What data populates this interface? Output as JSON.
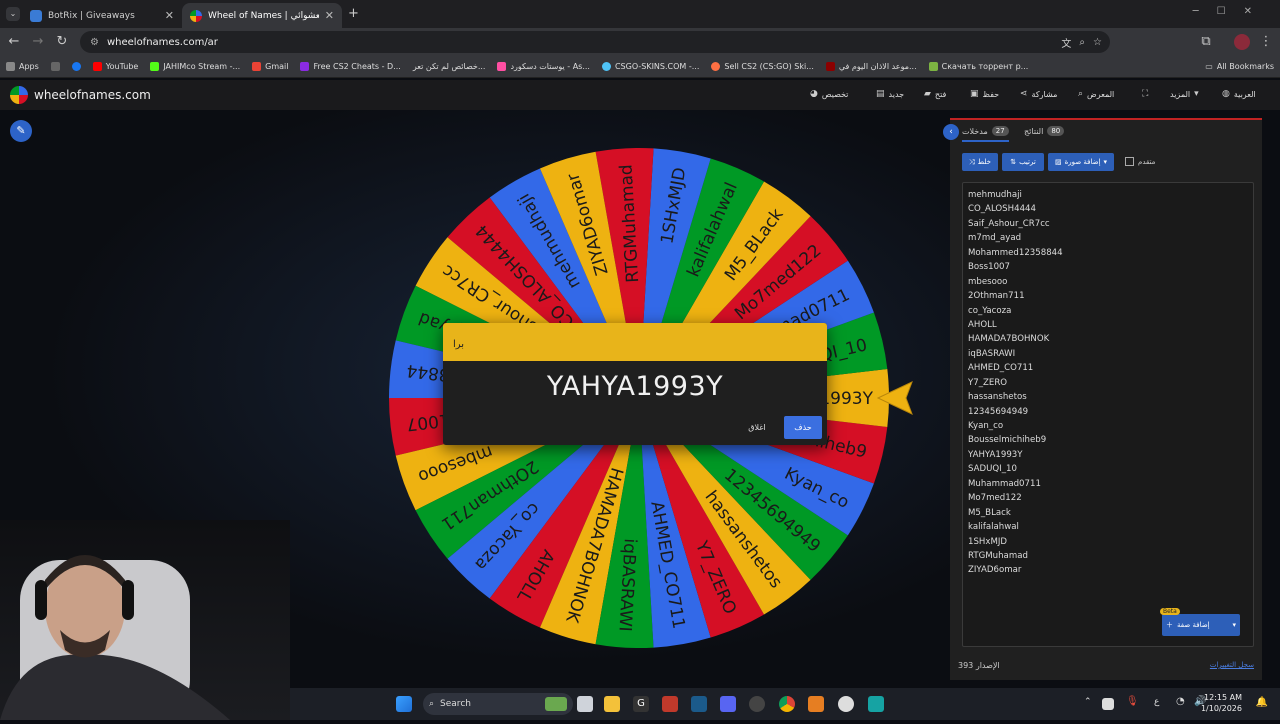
{
  "browser": {
    "tabs": [
      {
        "title": "BotRix | Giveaways",
        "favicon_color": "#3a7bd5"
      },
      {
        "title": "Wheel of Names | عجلة الاسم العشوائي",
        "favicon_color": "#d50f25"
      }
    ],
    "new_tab": "+",
    "url": "wheelofnames.com/ar",
    "bookmarks": [
      {
        "label": "Apps",
        "color": "#888888"
      },
      {
        "label": "",
        "color": "#666666"
      },
      {
        "label": "",
        "color": "#1877f2"
      },
      {
        "label": "YouTube",
        "color": "#ff0000"
      },
      {
        "label": "JAHIMco Stream -...",
        "color": "#53fc18"
      },
      {
        "label": "Gmail",
        "color": "#ea4335"
      },
      {
        "label": "Free CS2 Cheats - D...",
        "color": "#8a2be2"
      },
      {
        "label": "خصائص لم تكن تعر...",
        "color": "#666666"
      },
      {
        "label": "يوستات دسكورد - As...",
        "color": "#ff4fa3"
      },
      {
        "label": "CSGO-SKINS.COM -...",
        "color": "#4fc3f7"
      },
      {
        "label": "Sell CS2 (CS:GO) Ski...",
        "color": "#ff7043"
      },
      {
        "label": "موعد الاذان اليوم في...",
        "color": "#8b0000"
      },
      {
        "label": "Скачать торрент р...",
        "color": "#7cb342"
      }
    ],
    "all_bookmarks": "All Bookmarks"
  },
  "site": {
    "logo": "wheelofnames.com",
    "menu": [
      {
        "label": "العربية",
        "icon": "globe-icon"
      },
      {
        "label": "المزيد",
        "icon": "chevron-down-icon"
      },
      {
        "label": "",
        "icon": "fullscreen-icon"
      },
      {
        "label": "المعرض",
        "icon": "search-icon"
      },
      {
        "label": "مشاركة",
        "icon": "share-icon"
      },
      {
        "label": "حفظ",
        "icon": "save-icon"
      },
      {
        "label": "فتح",
        "icon": "folder-icon"
      },
      {
        "label": "جديد",
        "icon": "new-file-icon"
      },
      {
        "label": "تخصيص",
        "icon": "palette-icon"
      }
    ]
  },
  "wheel": {
    "slice_colors": [
      "#3369e8",
      "#d50f25",
      "#eeb211",
      "#009925"
    ],
    "pointer_color": "#eeb211",
    "entries": [
      "mehmudhaji",
      "CO_ALOSH4444",
      "Saif_Ashour_CR7cc",
      "m7md_ayad",
      "Mohammed12358844",
      "Boss1007",
      "mbesooo",
      "2Othman711",
      "co_Yacoza",
      "AHOLL",
      "HAMADA7BOHNOK",
      "iqBASRAWI",
      "AHMED_CO711",
      "Y7_ZERO",
      "hassanshetos",
      "12345694949",
      "Kyan_co",
      "Bousselmichiheb9",
      "YAHYA1993Y",
      "SADUQI_10",
      "Muhammad0711",
      "Mo7med122",
      "M5_BLack",
      "kalifalahwal",
      "1SHxMJD",
      "RTGMuhamad",
      "ZIYAD6omar"
    ]
  },
  "dialog": {
    "title": "برا",
    "winner": "YAHYA1993Y",
    "remove_label": "حذف",
    "close_label": "اغلاق"
  },
  "panel": {
    "tab_entries": "مدخلات",
    "entries_count": "27",
    "tab_results": "النتائج",
    "results_count": "80",
    "shuffle": "خلط",
    "sort": "ترتيب",
    "add_image": "إضافة صورة",
    "advanced": "متقدم",
    "add_image_btn": "إضافة صفة",
    "beta": "Beta",
    "version_label": "الإصدار",
    "version": "393",
    "changelog": "سجل التغييرات"
  },
  "taskbar": {
    "search": "Search",
    "time": "12:15 AM",
    "date": "1/10/2026",
    "lang": "ع"
  }
}
